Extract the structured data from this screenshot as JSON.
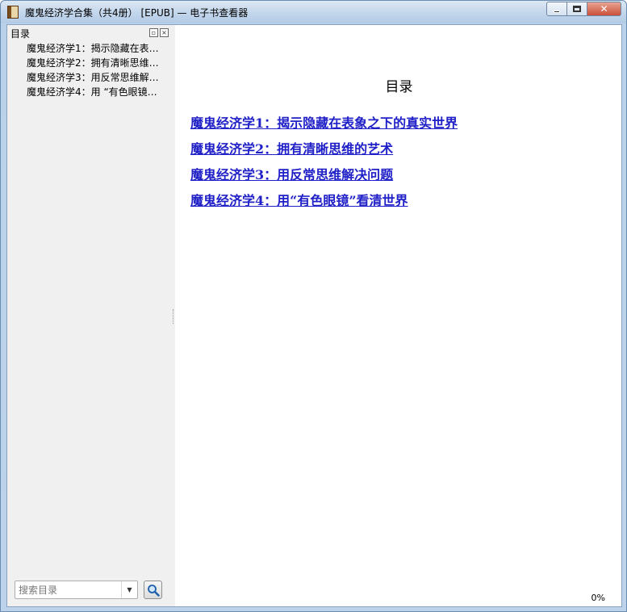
{
  "window": {
    "title": "魔鬼经济学合集（共4册） [EPUB] — 电子书查看器"
  },
  "sidebar": {
    "header": "目录",
    "items": [
      {
        "label": "魔鬼经济学1：揭示隐藏在表…"
      },
      {
        "label": "魔鬼经济学2：拥有清晰思维…"
      },
      {
        "label": "魔鬼经济学3：用反常思维解…"
      },
      {
        "label": "魔鬼经济学4：用 “有色眼镜…"
      }
    ],
    "search": {
      "placeholder": "搜索目录"
    }
  },
  "content": {
    "title": "目录",
    "links": [
      {
        "label": "魔鬼经济学1：揭示隐藏在表象之下的真实世界"
      },
      {
        "label": "魔鬼经济学2：拥有清晰思维的艺术"
      },
      {
        "label": "魔鬼经济学3：用反常思维解决问题"
      },
      {
        "label": "魔鬼经济学4：用“有色眼镜”看清世界"
      }
    ]
  },
  "status": {
    "progress": "0%"
  },
  "icons": {
    "app": "book-icon",
    "search": "magnifier-icon",
    "float": "restore-icon",
    "close": "close-icon"
  }
}
